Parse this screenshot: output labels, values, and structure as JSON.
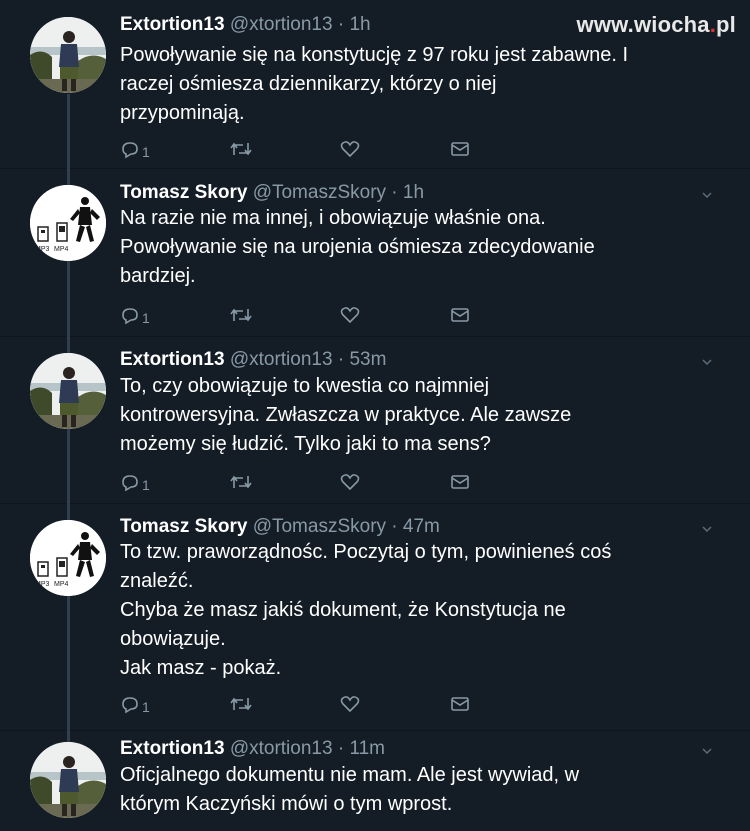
{
  "watermark": {
    "prefix": "www.",
    "mid": "wiocha",
    "dot": ".",
    "suffix": "pl"
  },
  "tweets": [
    {
      "name": "Extortion13",
      "handle": "@xtortion13",
      "sep": " · ",
      "time": "1h",
      "text": "Powoływanie się na konstytucję z 97 roku jest zabawne. I\nraczej ośmiesza dziennikarzy, którzy o niej\nprzypominają.",
      "replies": "1",
      "avatar_icon": "profile-photo-man-icon"
    },
    {
      "name": "Tomasz Skory",
      "handle": "@TomaszSkory",
      "sep": " · ",
      "time": "1h",
      "text": "Na razie nie ma innej, i obowiązuje właśnie ona.\nPowoływanie się na urojenia ośmiesza zdecydowanie\nbardziej.",
      "replies": "1",
      "avatar_icon": "mp3-mp4-logo-icon",
      "avatar_text": [
        "MP3",
        "MP4"
      ]
    },
    {
      "name": "Extortion13",
      "handle": "@xtortion13",
      "sep": " · ",
      "time": "53m",
      "text": "To, czy obowiązuje to kwestia co najmniej\nkontrowersyjna. Zwłaszcza w praktyce. Ale zawsze\nmożemy się łudzić. Tylko jaki to ma sens?",
      "replies": "1",
      "avatar_icon": "profile-photo-man-icon"
    },
    {
      "name": "Tomasz Skory",
      "handle": "@TomaszSkory",
      "sep": " · ",
      "time": "47m",
      "text": "To tzw. praworządnośc. Poczytaj o tym, powinieneś coś\nznaleźć.\nChyba że masz jakiś dokument, że Konstytucja ne\nobowiązuje.\nJak masz - pokaż.",
      "replies": "1",
      "avatar_icon": "mp3-mp4-logo-icon",
      "avatar_text": [
        "MP3",
        "MP4"
      ]
    },
    {
      "name": "Extortion13",
      "handle": "@xtortion13",
      "sep": " · ",
      "time": "11m",
      "text": "Oficjalnego dokumentu nie mam. Ale jest wywiad, w\nktórym Kaczyński mówi o tym wprost.",
      "avatar_icon": "profile-photo-man-icon"
    }
  ],
  "icons": {
    "reply": "reply-icon",
    "retweet": "retweet-icon",
    "like": "heart-icon",
    "dm": "envelope-icon",
    "more": "chevron-down-icon"
  },
  "colors": {
    "background": "#141d26",
    "text": "#ffffff",
    "secondary": "#8899a6",
    "thread_line": "#2f3f50",
    "watermark_dot": "#d9342b"
  }
}
